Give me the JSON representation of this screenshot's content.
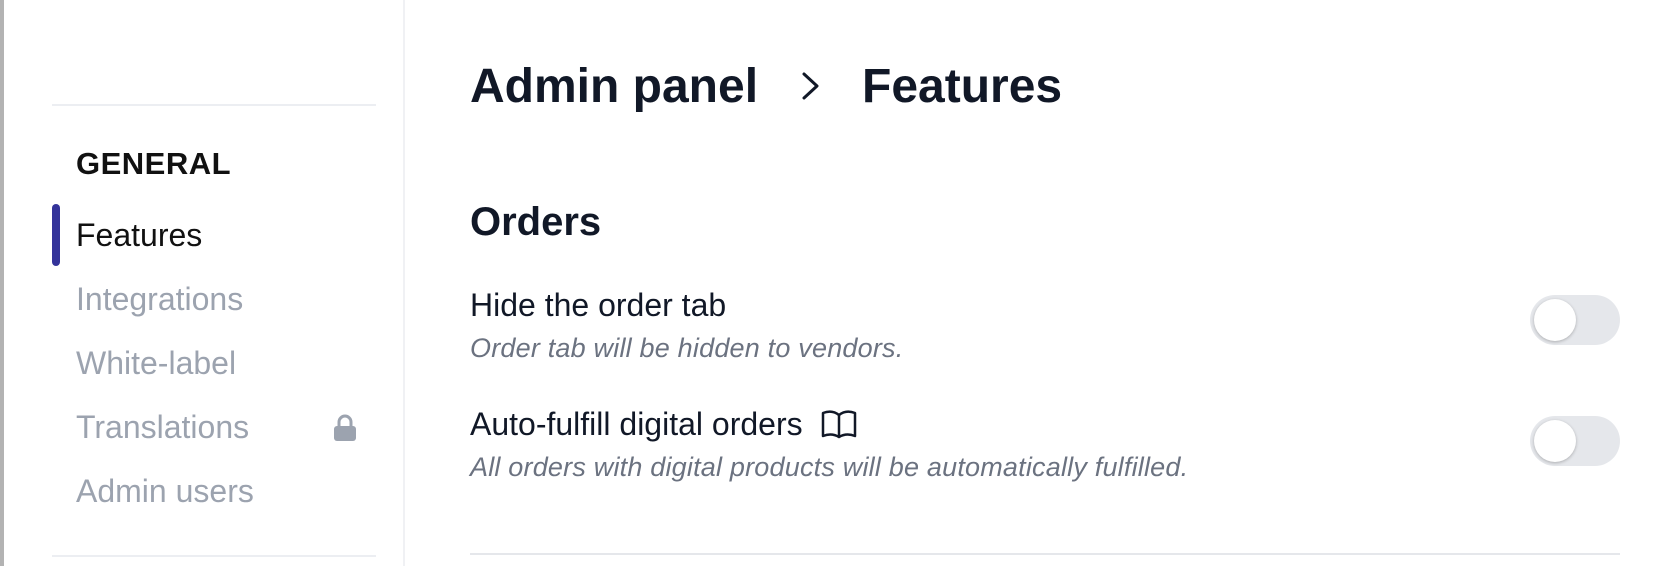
{
  "sidebar": {
    "section_heading": "GENERAL",
    "items": [
      {
        "label": "Features",
        "active": true
      },
      {
        "label": "Integrations",
        "active": false
      },
      {
        "label": "White-label",
        "active": false
      },
      {
        "label": "Translations",
        "active": false,
        "icon": "lock-icon"
      },
      {
        "label": "Admin users",
        "active": false
      }
    ],
    "accent_color": "#34339a"
  },
  "breadcrumb": {
    "root": "Admin panel",
    "separator_icon": "chevron-right-icon",
    "current": "Features"
  },
  "orders": {
    "title": "Orders",
    "settings": [
      {
        "title": "Hide the order tab",
        "description": "Order tab will be hidden to vendors.",
        "enabled": false
      },
      {
        "title": "Auto-fulfill digital orders",
        "icon": "book-icon",
        "description": "All orders with digital products will be automatically fulfilled.",
        "enabled": false
      }
    ]
  }
}
